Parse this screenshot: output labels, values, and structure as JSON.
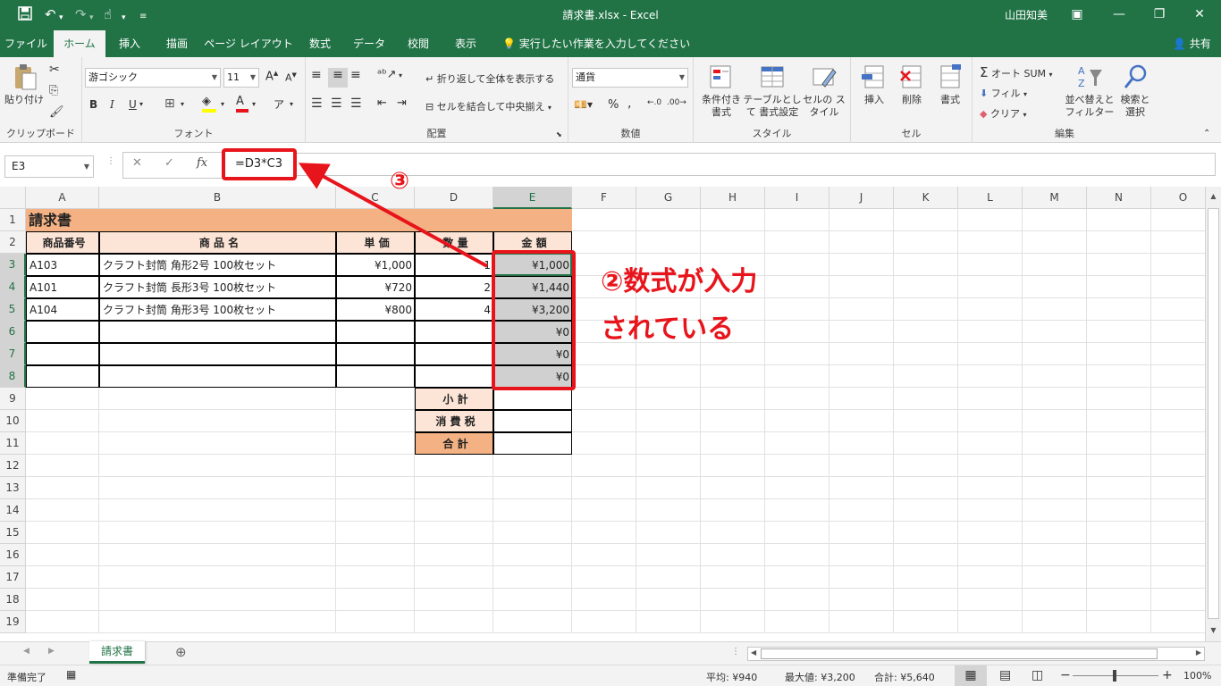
{
  "titlebar": {
    "title": "請求書.xlsx  -  Excel",
    "user": "山田知美",
    "qa_icons": [
      "save-icon",
      "undo-icon",
      "redo-icon",
      "touch-mode-icon",
      "customize-icon"
    ]
  },
  "menu": {
    "tabs": [
      "ファイル",
      "ホーム",
      "挿入",
      "描画",
      "ページ レイアウト",
      "数式",
      "データ",
      "校閲",
      "表示"
    ],
    "active": "ホーム",
    "tell_me": "実行したい作業を入力してください",
    "share": "共有"
  },
  "ribbon": {
    "clipboard": {
      "paste": "貼り付け",
      "label": "クリップボード"
    },
    "font": {
      "name": "游ゴシック",
      "size": "11",
      "bold": "B",
      "italic": "I",
      "underline": "U",
      "label": "フォント"
    },
    "alignment": {
      "wrap": "折り返して全体を表示する",
      "merge": "セルを結合して中央揃え",
      "label": "配置"
    },
    "number": {
      "format": "通貨",
      "label": "数値"
    },
    "styles": {
      "conditional": "条件付き 書式",
      "table": "テーブルとして 書式設定",
      "cell": "セルの スタイル",
      "label": "スタイル"
    },
    "cells": {
      "insert": "挿入",
      "delete": "削除",
      "format": "書式",
      "label": "セル"
    },
    "editing": {
      "autosum": "オート SUM",
      "fill": "フィル",
      "clear": "クリア",
      "sort": "並べ替えと フィルター",
      "find": "検索と 選択",
      "label": "編集"
    }
  },
  "formula_bar": {
    "name_box": "E3",
    "formula": "=D3*C3",
    "fx": "fx"
  },
  "columns": [
    "A",
    "B",
    "C",
    "D",
    "E",
    "F",
    "G",
    "H",
    "I",
    "J",
    "K",
    "L",
    "M",
    "N",
    "O"
  ],
  "rows": [
    "1",
    "2",
    "3",
    "4",
    "5",
    "6",
    "7",
    "8",
    "9",
    "10",
    "11",
    "12",
    "13",
    "14",
    "15",
    "16",
    "17",
    "18",
    "19"
  ],
  "selected": {
    "column": "E",
    "rows": [
      "3",
      "4",
      "5",
      "6",
      "7",
      "8"
    ]
  },
  "sheet": {
    "title": "請求書",
    "headers": [
      "商品番号",
      "商 品 名",
      "単 価",
      "数 量",
      "金 額"
    ],
    "items": [
      {
        "code": "A103",
        "name": "クラフト封筒 角形2号 100枚セット",
        "price": "¥1,000",
        "qty": "1",
        "amount": "¥1,000"
      },
      {
        "code": "A101",
        "name": "クラフト封筒 長形3号 100枚セット",
        "price": "¥720",
        "qty": "2",
        "amount": "¥1,440"
      },
      {
        "code": "A104",
        "name": "クラフト封筒 角形3号 100枚セット",
        "price": "¥800",
        "qty": "4",
        "amount": "¥3,200"
      },
      {
        "code": "",
        "name": "",
        "price": "",
        "qty": "",
        "amount": "¥0"
      },
      {
        "code": "",
        "name": "",
        "price": "",
        "qty": "",
        "amount": "¥0"
      },
      {
        "code": "",
        "name": "",
        "price": "",
        "qty": "",
        "amount": "¥0"
      }
    ],
    "subtotal_label": "小 計",
    "tax_label": "消 費 税",
    "total_label": "合 計",
    "colors": {
      "title_bg": "#f4b183",
      "header_bg": "#fce4d6",
      "selection": "#d0d0d0",
      "excel_green": "#217346",
      "annotation_red": "#e8141b"
    }
  },
  "annotations": {
    "step2": "②数式が入力",
    "step2_line2": "されている",
    "step3": "③"
  },
  "sheet_tabs": {
    "active": "請求書"
  },
  "status": {
    "ready": "準備完了",
    "average": "平均: ¥940",
    "max": "最大値: ¥3,200",
    "sum": "合計: ¥5,640",
    "zoom": "100%"
  }
}
